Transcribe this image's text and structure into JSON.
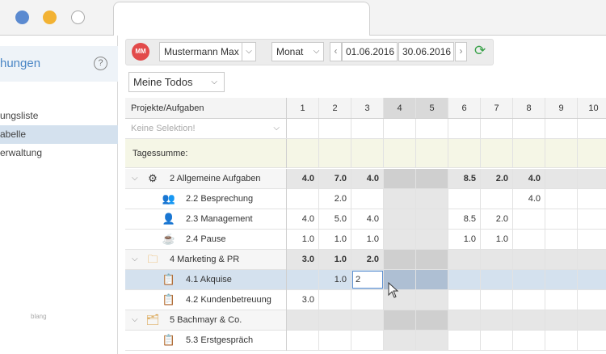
{
  "window": {
    "title": ""
  },
  "sidebar": {
    "title": "hungen",
    "help_icon_label": "?",
    "items": [
      {
        "label": "ungsliste",
        "active": false
      },
      {
        "label": "abelle",
        "active": true
      },
      {
        "label": "erwaltung",
        "active": false
      }
    ],
    "footer": "blang"
  },
  "toolbar": {
    "avatar_initials": "MM",
    "user": "Mustermann Max",
    "period": "Monat",
    "date_from": "01.06.2016",
    "date_to": "30.06.2016",
    "prev_icon": "chevron-left-icon",
    "next_icon": "chevron-right-icon",
    "refresh_icon": "refresh-icon"
  },
  "view_select": {
    "value": "Meine Todos"
  },
  "grid": {
    "header_label": "Projekte/Aufgaben",
    "filter_placeholder": "Keine Selektion!",
    "sum_label": "Tagessumme:",
    "days": [
      "1",
      "2",
      "3",
      "4",
      "5",
      "6",
      "7",
      "8",
      "9",
      "10"
    ],
    "weekend_days": [
      "4",
      "5"
    ],
    "rows": [
      {
        "name": "2 Allgemeine Aufgaben",
        "level": 0,
        "icon": "gear-icon",
        "bold": true,
        "values": [
          "4.0",
          "7.0",
          "4.0",
          "",
          "",
          "8.5",
          "2.0",
          "4.0",
          "",
          ""
        ]
      },
      {
        "name": "2.2 Besprechung",
        "level": 1,
        "icon": "people-icon",
        "bold": false,
        "values": [
          "",
          "2.0",
          "",
          "",
          "",
          "",
          "",
          "4.0",
          "",
          ""
        ]
      },
      {
        "name": "2.3 Management",
        "level": 1,
        "icon": "person-icon",
        "bold": false,
        "values": [
          "4.0",
          "5.0",
          "4.0",
          "",
          "",
          "8.5",
          "2.0",
          "",
          "",
          ""
        ]
      },
      {
        "name": "2.4 Pause",
        "level": 1,
        "icon": "coffee-icon",
        "bold": false,
        "values": [
          "1.0",
          "1.0",
          "1.0",
          "",
          "",
          "1.0",
          "1.0",
          "",
          "",
          ""
        ]
      },
      {
        "name": "4 Marketing & PR",
        "level": 0,
        "icon": "folder-icon",
        "bold": true,
        "values": [
          "3.0",
          "1.0",
          "2.0",
          "",
          "",
          "",
          "",
          "",
          "",
          ""
        ]
      },
      {
        "name": "4.1 Akquise",
        "level": 1,
        "icon": "clipboard-icon",
        "bold": false,
        "selected": true,
        "values": [
          "",
          "1.0",
          "2",
          "",
          "",
          "",
          "",
          "",
          "",
          ""
        ]
      },
      {
        "name": "4.2 Kundenbetreuung",
        "level": 1,
        "icon": "clipboard-icon",
        "bold": false,
        "values": [
          "3.0",
          "",
          "",
          "",
          "",
          "",
          "",
          "",
          "",
          ""
        ]
      },
      {
        "name": "5 Bachmayr & Co.",
        "level": 0,
        "icon": "folder-list-icon",
        "bold": false,
        "values": [
          "",
          "",
          "",
          "",
          "",
          "",
          "",
          "",
          "",
          ""
        ]
      },
      {
        "name": "5.3 Erstgespräch",
        "level": 1,
        "icon": "clipboard-icon",
        "bold": false,
        "values": [
          "",
          "",
          "",
          "",
          "",
          "",
          "",
          "",
          "",
          ""
        ]
      }
    ]
  },
  "colors": {
    "accent": "#4a86c5",
    "selection": "#d4e1ee",
    "sum_row": "#f5f6e6",
    "weekend": "#d9d9d9",
    "refresh": "#3aa24a",
    "avatar": "#e24a4a"
  }
}
